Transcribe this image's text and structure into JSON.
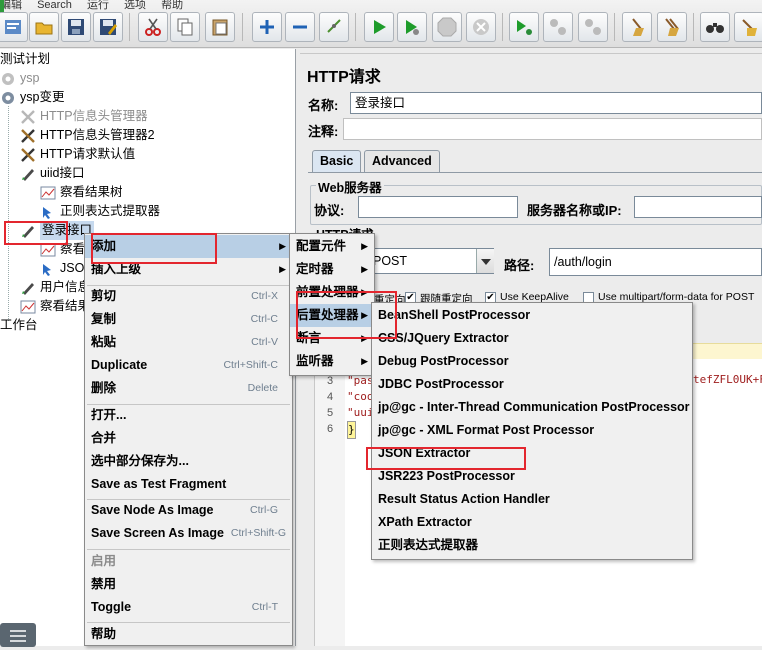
{
  "menubar": [
    "编辑",
    "Search",
    "运行",
    "选项",
    "帮助"
  ],
  "toolbar": {
    "icons": [
      "test-plan-icon",
      "open-icon",
      "save-icon",
      "save-as-icon",
      "cut-icon",
      "copy-icon",
      "paste-icon",
      "expand-icon",
      "collapse-icon",
      "toggle-icon",
      "start-icon",
      "start-no-pause-icon",
      "stop-icon",
      "shutdown-icon",
      "remote-start-icon",
      "remote-stop-icon",
      "remote-shutdown-icon",
      "clear-icon",
      "clear-all-icon",
      "search-icon",
      "reset-search-icon"
    ]
  },
  "tree": {
    "items": [
      {
        "label": "测试计划",
        "icon": "test-plan"
      },
      {
        "label": "ysp",
        "icon": "gear",
        "disabled": true
      },
      {
        "label": "ysp变更",
        "icon": "gear"
      },
      {
        "label": "HTTP信息头管理器",
        "icon": "tools",
        "disabled": true
      },
      {
        "label": "HTTP信息头管理器2",
        "icon": "tools"
      },
      {
        "label": "HTTP请求默认值",
        "icon": "tools"
      },
      {
        "label": "uiid接口",
        "icon": "pen"
      },
      {
        "label": "察看结果树",
        "icon": "chart"
      },
      {
        "label": "正则表达式提取器",
        "icon": "arrow"
      },
      {
        "label": "登录接口",
        "icon": "pen",
        "selected": true
      },
      {
        "label": "察看",
        "icon": "chart"
      },
      {
        "label": "JSO",
        "icon": "arrow"
      },
      {
        "label": "用户信息",
        "icon": "pen"
      },
      {
        "label": "察看结果",
        "icon": "chart"
      },
      {
        "label": "工作台",
        "icon": "workbench"
      }
    ]
  },
  "panel": {
    "title": "HTTP请求",
    "name_label": "名称:",
    "name_value": "登录接口",
    "comment_label": "注释:",
    "comment_value": "",
    "tabs": [
      "Basic",
      "Advanced"
    ],
    "web_server_legend": "Web服务器",
    "protocol_label": "协议:",
    "server_label": "服务器名称或IP:",
    "http_request_legend": "HTTP请求",
    "method_value": "POST",
    "path_label": "路径:",
    "path_value": "/auth/login",
    "options": [
      {
        "label": "重定向",
        "checked": false
      },
      {
        "label": "跟随重定向",
        "checked": true
      },
      {
        "label": "Use KeepAlive",
        "checked": true
      },
      {
        "label": "Use multipart/form-data for POST",
        "checked": false
      }
    ],
    "body_lines": [
      {
        "num": "3",
        "text": "\"pas"
      },
      {
        "num": "4",
        "text": "\"coo"
      },
      {
        "num": "5",
        "text": "\"uui"
      },
      {
        "num": "6",
        "text": "}"
      }
    ],
    "body_tail": "tefZFL0UK+F"
  },
  "context_menu": {
    "items": [
      {
        "label": "添加",
        "submenu": true
      },
      {
        "label": "插入上级",
        "submenu": true
      },
      {
        "label": "剪切",
        "shortcut": "Ctrl-X"
      },
      {
        "label": "复制",
        "shortcut": "Ctrl-C"
      },
      {
        "label": "粘贴",
        "shortcut": "Ctrl-V"
      },
      {
        "label": "Duplicate",
        "shortcut": "Ctrl+Shift-C"
      },
      {
        "label": "删除",
        "shortcut": "Delete"
      },
      {
        "label": "打开..."
      },
      {
        "label": "合并"
      },
      {
        "label": "选中部分保存为..."
      },
      {
        "label": "Save as Test Fragment"
      },
      {
        "label": "Save Node As Image",
        "shortcut": "Ctrl-G"
      },
      {
        "label": "Save Screen As Image",
        "shortcut": "Ctrl+Shift-G"
      },
      {
        "label": "启用",
        "disabled": true
      },
      {
        "label": "禁用"
      },
      {
        "label": "Toggle",
        "shortcut": "Ctrl-T"
      },
      {
        "label": "帮助"
      }
    ]
  },
  "add_submenu": {
    "items": [
      "配置元件",
      "定时器",
      "前置处理器",
      "后置处理器",
      "断言",
      "监听器"
    ]
  },
  "post_processor_submenu": {
    "items": [
      "BeanShell PostProcessor",
      "CSS/JQuery Extractor",
      "Debug PostProcessor",
      "JDBC PostProcessor",
      "jp@gc - Inter-Thread Communication PostProcessor",
      "jp@gc - XML Format Post Processor",
      "JSON Extractor",
      "JSR223 PostProcessor",
      "Result Status Action Handler",
      "XPath Extractor",
      "正则表达式提取器"
    ]
  },
  "colors": {
    "highlight_box": "#e3262e",
    "menu_selection": "#b8cfe5",
    "tree_selection": "#c6d9ee"
  }
}
